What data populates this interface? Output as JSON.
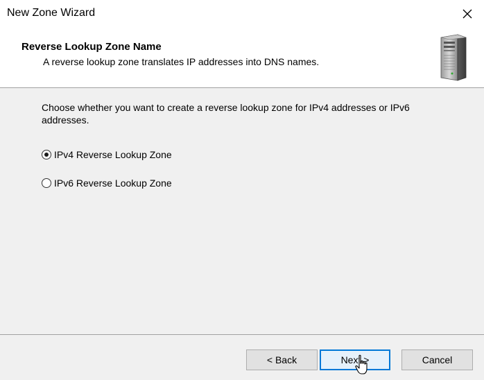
{
  "window": {
    "title": "New Zone Wizard"
  },
  "header": {
    "title": "Reverse Lookup Zone Name",
    "subtitle": "A reverse lookup zone translates IP addresses into DNS names.",
    "icon": "server-tower-icon"
  },
  "content": {
    "instruction": "Choose whether you want to create a reverse lookup zone for IPv4 addresses or IPv6 addresses.",
    "options": [
      {
        "label": "IPv4 Reverse Lookup Zone",
        "selected": true
      },
      {
        "label": "IPv6 Reverse Lookup Zone",
        "selected": false
      }
    ]
  },
  "footer": {
    "back_label": "< Back",
    "next_label": "Next >",
    "cancel_label": "Cancel"
  },
  "colors": {
    "accent": "#0078d7",
    "panel_bg": "#f0f0f0",
    "header_bg": "#ffffff"
  }
}
